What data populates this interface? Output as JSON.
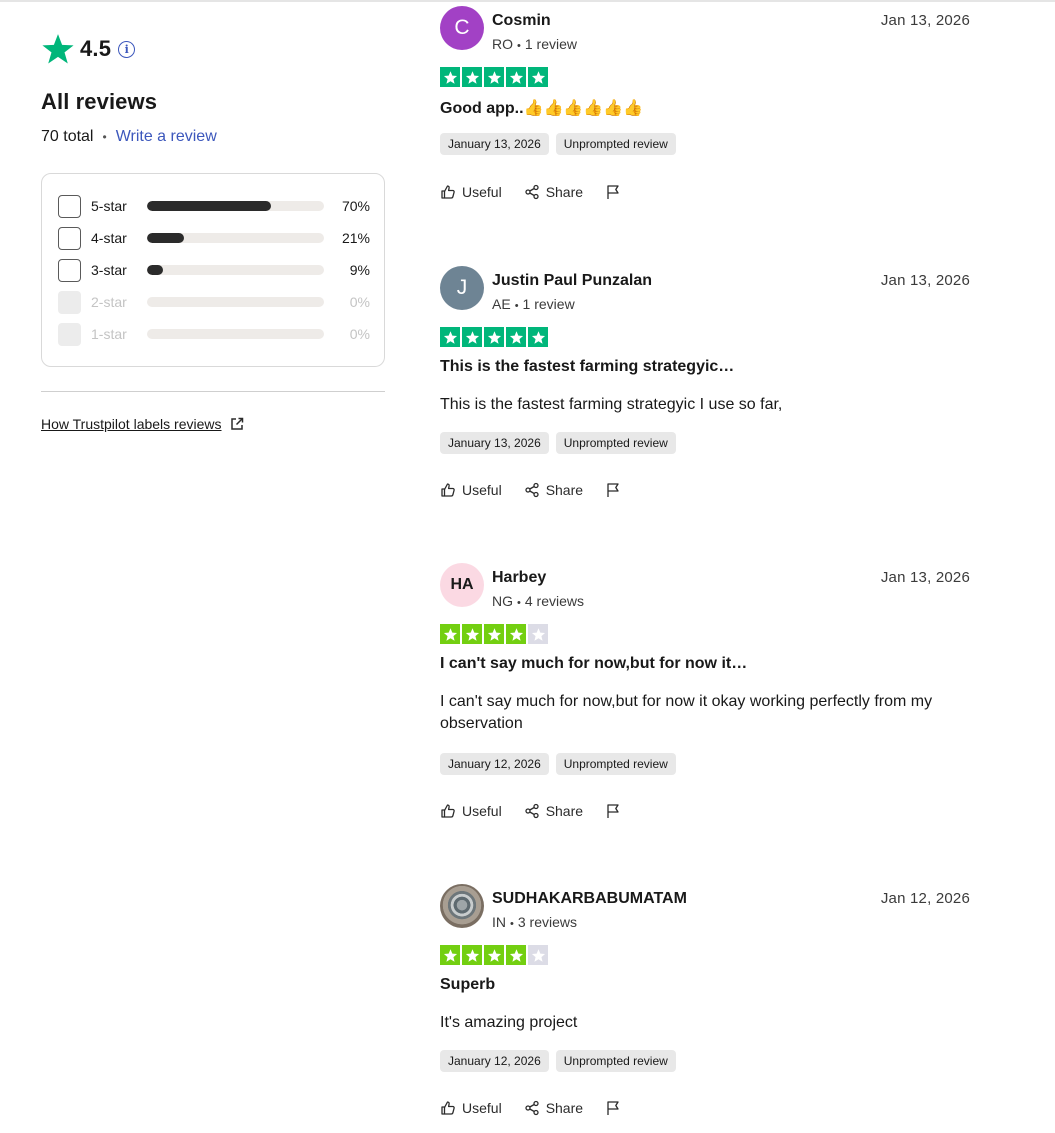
{
  "summary": {
    "rating": "4.5",
    "info_icon": "info-icon",
    "title": "All reviews",
    "total": "70 total",
    "separator": "•",
    "write_review": "Write a review",
    "distribution": [
      {
        "label": "5-star",
        "percent_label": "70%",
        "fraction": 0.7,
        "enabled": true
      },
      {
        "label": "4-star",
        "percent_label": "21%",
        "fraction": 0.21,
        "enabled": true
      },
      {
        "label": "3-star",
        "percent_label": "9%",
        "fraction": 0.09,
        "enabled": true
      },
      {
        "label": "2-star",
        "percent_label": "0%",
        "fraction": 0,
        "enabled": false
      },
      {
        "label": "1-star",
        "percent_label": "0%",
        "fraction": 0,
        "enabled": false
      }
    ],
    "labels_link": "How Trustpilot labels reviews"
  },
  "colors": {
    "trustpilot_green": "#00b67a",
    "star_5_bg": "#00b67a",
    "star_4_bg": "#73cf11",
    "empty_star_bg": "#dcdce6",
    "link_blue": "#3c57bc"
  },
  "reviews": [
    {
      "avatar_text": "C",
      "name": "Cosmin",
      "country": "RO",
      "review_count": "1 review",
      "date": "Jan 13, 2026",
      "stars": 5,
      "title": "Good app..👍👍👍👍👍👍",
      "body": "",
      "experience_date": "January 13, 2026",
      "tag": "Unprompted review",
      "useful": "Useful",
      "share": "Share"
    },
    {
      "avatar_text": "J",
      "name": "Justin Paul Punzalan",
      "country": "AE",
      "review_count": "1 review",
      "date": "Jan 13, 2026",
      "stars": 5,
      "title": "This is the fastest farming strategyic…",
      "body": "This is the fastest farming strategyic I use so far,",
      "experience_date": "January 13, 2026",
      "tag": "Unprompted review",
      "useful": "Useful",
      "share": "Share"
    },
    {
      "avatar_text": "HA",
      "name": "Harbey",
      "country": "NG",
      "review_count": "4 reviews",
      "date": "Jan 13, 2026",
      "stars": 4,
      "title": "I can't say much for now,but for now it…",
      "body": "I can't say much for now,but for now it okay working perfectly from my observation",
      "experience_date": "January 12, 2026",
      "tag": "Unprompted review",
      "useful": "Useful",
      "share": "Share"
    },
    {
      "avatar_text": "",
      "name": "SUDHAKARBABUMATAM",
      "country": "IN",
      "review_count": "3 reviews",
      "date": "Jan 12, 2026",
      "stars": 4,
      "title": "Superb",
      "body": "It's amazing project",
      "experience_date": "January 12, 2026",
      "tag": "Unprompted review",
      "useful": "Useful",
      "share": "Share"
    }
  ]
}
